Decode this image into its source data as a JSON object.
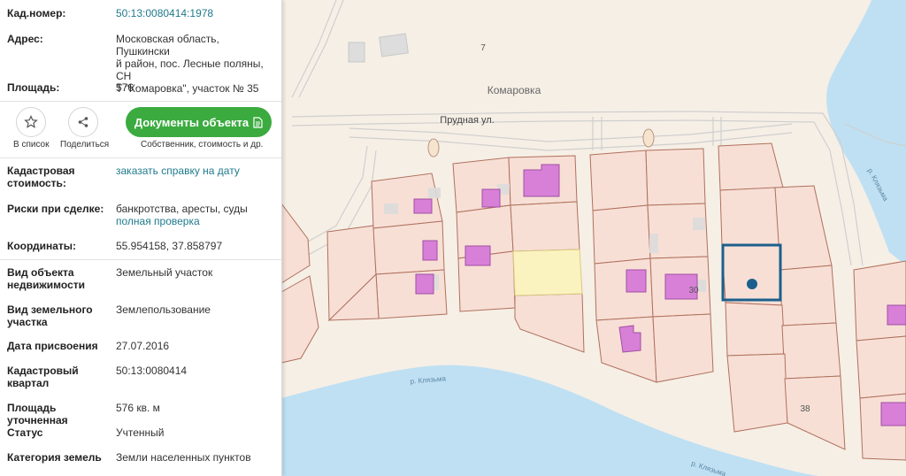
{
  "panel": {
    "cadastral_number": {
      "label": "Кад.номер:",
      "value": "50:13:0080414:1978"
    },
    "address": {
      "label": "Адрес:",
      "lines": [
        "Московская область, Пушкински",
        "й район, пос. Лесные поляны, СН",
        "Т \"Комаровка\", участок № 35"
      ]
    },
    "area": {
      "label": "Площадь:",
      "value": "576"
    },
    "actions": {
      "favorite_label": "В список",
      "share_label": "Поделиться",
      "documents_button": "Документы объекта",
      "documents_sub": "Собственник, стоимость и др."
    },
    "cadastral_cost": {
      "label_lines": [
        "Кадастровая",
        "стоимость:"
      ],
      "link": "заказать справку на дату"
    },
    "risks": {
      "label": "Риски при сделке:",
      "value": "банкротства, аресты, суды",
      "link": "полная проверка"
    },
    "coordinates": {
      "label": "Координаты:",
      "value": "55.954158, 37.858797"
    },
    "object_type": {
      "label_lines": [
        "Вид объекта",
        "недвижимости"
      ],
      "value": "Земельный участок"
    },
    "land_type": {
      "label_lines": [
        "Вид земельного",
        "участка"
      ],
      "value": "Землепользование"
    },
    "assigned_date": {
      "label": "Дата присвоения",
      "value": "27.07.2016"
    },
    "quarter": {
      "label_lines": [
        "Кадастровый",
        "квартал"
      ],
      "value": "50:13:0080414"
    },
    "refined_area": {
      "label": "Площадь уточненная",
      "value": "576 кв. м"
    },
    "status": {
      "label": "Статус",
      "value": "Учтенный"
    },
    "land_category": {
      "label": "Категория земель",
      "value": "Земли населенных пунктов"
    }
  },
  "map": {
    "place_name": "Комаровка",
    "street_name": "Прудная ул.",
    "river_labels": [
      "р. Клязьма",
      "р. Клязьма",
      "р. Клязьма"
    ],
    "plot_numbers": [
      "7",
      "30",
      "38"
    ],
    "colors": {
      "water": "#bfe0f2",
      "parcel_fill": "#f7dfd6",
      "parcel_border": "#b0705c",
      "building": "#d880d8",
      "selected_outline": "#1c5f8c",
      "highlight_parcel": "#fbf3bf",
      "accent_green": "#3bab3f",
      "link": "#1f7a8c"
    }
  }
}
